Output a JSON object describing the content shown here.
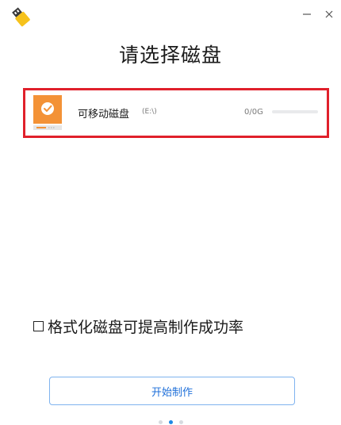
{
  "title_bar": {
    "logo_icon": "usb-flash-drive-icon",
    "minimize_icon": "minimize-icon",
    "close_icon": "close-icon"
  },
  "page": {
    "title": "请选择磁盘"
  },
  "disks": [
    {
      "name": "可移动磁盘",
      "drive": "(E:\\)",
      "capacity": "0/0G",
      "usage_fraction": 0,
      "selected": true,
      "icon": "removable-disk-icon",
      "check_icon": "check-icon"
    }
  ],
  "format_option": {
    "label": "格式化磁盘可提高制作成功率",
    "checked": false
  },
  "start_button": {
    "label": "开始制作"
  },
  "pager": {
    "count": 3,
    "active_index": 1
  },
  "colors": {
    "selection_border": "#e0202b",
    "disk_icon_orange": "#f39237",
    "accent_blue": "#1e88e5",
    "button_text": "#1e6fd9"
  }
}
